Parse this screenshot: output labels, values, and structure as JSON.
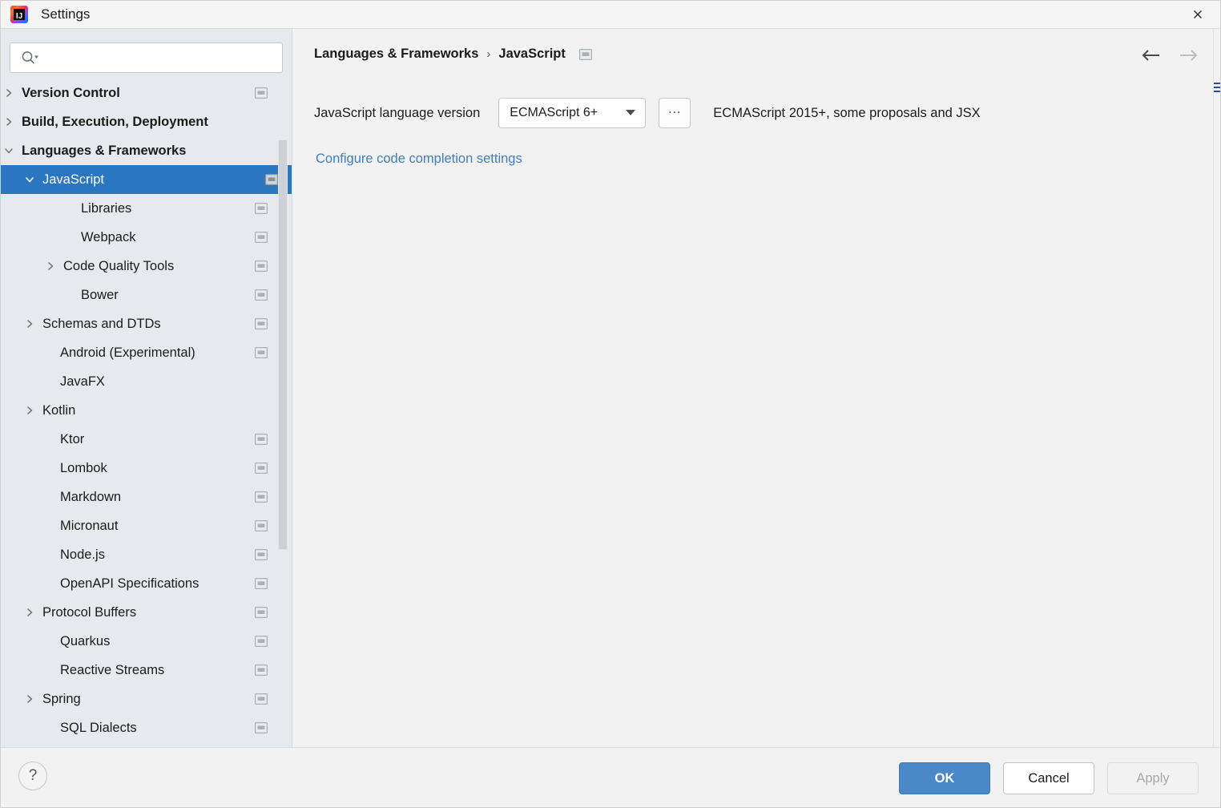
{
  "window": {
    "title": "Settings",
    "app_icon": "intellij-idea-icon",
    "close_icon": "close-icon"
  },
  "sidebar": {
    "search": {
      "value": "",
      "placeholder": "",
      "icon": "search-icon"
    },
    "items": [
      {
        "label": "Version Control",
        "indent": 22,
        "bold": true,
        "twisty": "right",
        "scope_icon": true
      },
      {
        "label": "Build, Execution, Deployment",
        "indent": 22,
        "bold": true,
        "twisty": "right",
        "scope_icon": false
      },
      {
        "label": "Languages & Frameworks",
        "indent": 22,
        "bold": true,
        "twisty": "down",
        "scope_icon": false
      },
      {
        "label": "JavaScript",
        "indent": 48,
        "bold": false,
        "twisty": "down",
        "scope_icon": true,
        "selected": true
      },
      {
        "label": "Libraries",
        "indent": 96,
        "bold": false,
        "twisty": "none",
        "scope_icon": true
      },
      {
        "label": "Webpack",
        "indent": 96,
        "bold": false,
        "twisty": "none",
        "scope_icon": true
      },
      {
        "label": "Code Quality Tools",
        "indent": 74,
        "bold": false,
        "twisty": "right",
        "scope_icon": true
      },
      {
        "label": "Bower",
        "indent": 96,
        "bold": false,
        "twisty": "none",
        "scope_icon": true
      },
      {
        "label": "Schemas and DTDs",
        "indent": 48,
        "bold": false,
        "twisty": "right",
        "scope_icon": true
      },
      {
        "label": "Android (Experimental)",
        "indent": 70,
        "bold": false,
        "twisty": "none",
        "scope_icon": true
      },
      {
        "label": "JavaFX",
        "indent": 70,
        "bold": false,
        "twisty": "none",
        "scope_icon": false
      },
      {
        "label": "Kotlin",
        "indent": 48,
        "bold": false,
        "twisty": "right",
        "scope_icon": false
      },
      {
        "label": "Ktor",
        "indent": 70,
        "bold": false,
        "twisty": "none",
        "scope_icon": true
      },
      {
        "label": "Lombok",
        "indent": 70,
        "bold": false,
        "twisty": "none",
        "scope_icon": true
      },
      {
        "label": "Markdown",
        "indent": 70,
        "bold": false,
        "twisty": "none",
        "scope_icon": true
      },
      {
        "label": "Micronaut",
        "indent": 70,
        "bold": false,
        "twisty": "none",
        "scope_icon": true
      },
      {
        "label": "Node.js",
        "indent": 70,
        "bold": false,
        "twisty": "none",
        "scope_icon": true
      },
      {
        "label": "OpenAPI Specifications",
        "indent": 70,
        "bold": false,
        "twisty": "none",
        "scope_icon": true
      },
      {
        "label": "Protocol Buffers",
        "indent": 48,
        "bold": false,
        "twisty": "right",
        "scope_icon": true
      },
      {
        "label": "Quarkus",
        "indent": 70,
        "bold": false,
        "twisty": "none",
        "scope_icon": true
      },
      {
        "label": "Reactive Streams",
        "indent": 70,
        "bold": false,
        "twisty": "none",
        "scope_icon": true
      },
      {
        "label": "Spring",
        "indent": 48,
        "bold": false,
        "twisty": "right",
        "scope_icon": true
      },
      {
        "label": "SQL Dialects",
        "indent": 70,
        "bold": false,
        "twisty": "none",
        "scope_icon": true
      }
    ]
  },
  "main": {
    "breadcrumb": {
      "parent": "Languages & Frameworks",
      "separator": "›",
      "current": "JavaScript",
      "scope_icon": "project-scope-icon"
    },
    "nav": {
      "back_icon": "arrow-left-icon",
      "forward_icon": "arrow-right-icon"
    },
    "version_row": {
      "label": "JavaScript language version",
      "combo_value": "ECMAScript 6+",
      "combo_arrow_icon": "chevron-down-icon",
      "ellipsis_label": "...",
      "note": "ECMAScript 2015+, some proposals and JSX"
    },
    "completion_link": "Configure code completion settings"
  },
  "bottom": {
    "help_label": "?",
    "ok_label": "OK",
    "cancel_label": "Cancel",
    "apply_label": "Apply"
  },
  "colors": {
    "selection_blue": "#2a76c0",
    "primary_button": "#4a88c7",
    "link_blue": "#3f7fbf",
    "sidebar_bg": "#e6eaee",
    "main_bg": "#f2f2f2"
  }
}
